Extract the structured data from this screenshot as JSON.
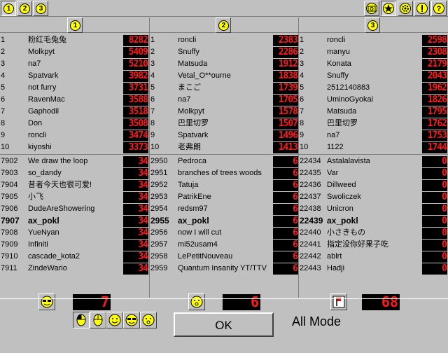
{
  "top_tabs": [
    "1",
    "2",
    "3"
  ],
  "top_right_icons": [
    "camera-icon",
    "star-icon",
    "settings-icon",
    "info-icon",
    "help-icon"
  ],
  "panels": [
    {
      "header": "1",
      "top": [
        {
          "rank": "1",
          "name": "粉红毛兔兔",
          "score": "8282"
        },
        {
          "rank": "2",
          "name": "Molkpyt",
          "score": "5409"
        },
        {
          "rank": "3",
          "name": "na7",
          "score": "5210"
        },
        {
          "rank": "4",
          "name": "Spatvark",
          "score": "3982"
        },
        {
          "rank": "5",
          "name": "not furry",
          "score": "3731"
        },
        {
          "rank": "6",
          "name": "RavenMac",
          "score": "3588"
        },
        {
          "rank": "7",
          "name": "Gaphodil",
          "score": "3518"
        },
        {
          "rank": "8",
          "name": "Don",
          "score": "3508"
        },
        {
          "rank": "9",
          "name": "roncli",
          "score": "3474"
        },
        {
          "rank": "10",
          "name": "kiyoshi",
          "score": "3373"
        }
      ],
      "nearby": [
        {
          "rank": "7902",
          "name": "We draw the loop",
          "score": "34"
        },
        {
          "rank": "7903",
          "name": "so_dandy",
          "score": "34"
        },
        {
          "rank": "7904",
          "name": "昔者今天也很可爱!",
          "score": "34"
        },
        {
          "rank": "7905",
          "name": "小飞",
          "score": "34"
        },
        {
          "rank": "7906",
          "name": "DudeAreShowering",
          "score": "34"
        },
        {
          "rank": "7907",
          "name": "ax_pokl",
          "score": "34",
          "me": true
        },
        {
          "rank": "7908",
          "name": "YueNyan",
          "score": "34"
        },
        {
          "rank": "7909",
          "name": "Infiniti",
          "score": "34"
        },
        {
          "rank": "7910",
          "name": "cascade_kota2",
          "score": "34"
        },
        {
          "rank": "7911",
          "name": "ZindeWario",
          "score": "34"
        }
      ],
      "footer_icon": "sunglasses-face-icon",
      "counter": "7"
    },
    {
      "header": "2",
      "top": [
        {
          "rank": "1",
          "name": "roncli",
          "score": "2383"
        },
        {
          "rank": "2",
          "name": "Snuffy",
          "score": "2286"
        },
        {
          "rank": "3",
          "name": "Matsuda",
          "score": "1912"
        },
        {
          "rank": "4",
          "name": "Vetal_O**ourne",
          "score": "1838"
        },
        {
          "rank": "5",
          "name": "まこご",
          "score": "1739"
        },
        {
          "rank": "6",
          "name": "na7",
          "score": "1705"
        },
        {
          "rank": "7",
          "name": "Molkpyt",
          "score": "1578"
        },
        {
          "rank": "8",
          "name": "巴里切罗",
          "score": "1507"
        },
        {
          "rank": "9",
          "name": "Spatvark",
          "score": "1496"
        },
        {
          "rank": "10",
          "name": "老弗朗",
          "score": "1413"
        }
      ],
      "nearby": [
        {
          "rank": "2950",
          "name": "Pedroca",
          "score": "6"
        },
        {
          "rank": "2951",
          "name": "branches of trees woods",
          "score": "6"
        },
        {
          "rank": "2952",
          "name": "Tatuja",
          "score": "6"
        },
        {
          "rank": "2953",
          "name": "PatrikEne",
          "score": "6"
        },
        {
          "rank": "2954",
          "name": "redsm97",
          "score": "6"
        },
        {
          "rank": "2955",
          "name": "ax_pokl",
          "score": "6",
          "me": true
        },
        {
          "rank": "2956",
          "name": "now I will cut",
          "score": "6"
        },
        {
          "rank": "2957",
          "name": "mi52usam4",
          "score": "6"
        },
        {
          "rank": "2958",
          "name": "LePetitNouveau",
          "score": "6"
        },
        {
          "rank": "2959",
          "name": "Quantum Insanity YT/TTV",
          "score": "6"
        }
      ],
      "footer_icon": "surprised-face-icon",
      "counter": "6"
    },
    {
      "header": "3",
      "top": [
        {
          "rank": "1",
          "name": "roncli",
          "score": "2598"
        },
        {
          "rank": "2",
          "name": "manyu",
          "score": "2308"
        },
        {
          "rank": "3",
          "name": "Konata",
          "score": "2179"
        },
        {
          "rank": "4",
          "name": "Snuffy",
          "score": "2043"
        },
        {
          "rank": "5",
          "name": "2512140883",
          "score": "1962"
        },
        {
          "rank": "6",
          "name": "UminoGyokai",
          "score": "1826"
        },
        {
          "rank": "7",
          "name": "Matsuda",
          "score": "1795"
        },
        {
          "rank": "8",
          "name": "巴里切罗",
          "score": "1762"
        },
        {
          "rank": "9",
          "name": "na7",
          "score": "1753"
        },
        {
          "rank": "10",
          "name": "1122",
          "score": "1744"
        }
      ],
      "nearby": [
        {
          "rank": "22434",
          "name": "Astalalavista",
          "score": "0"
        },
        {
          "rank": "22435",
          "name": "Var",
          "score": "0"
        },
        {
          "rank": "22436",
          "name": "Dillweed",
          "score": "0"
        },
        {
          "rank": "22437",
          "name": "Swoliczek",
          "score": "0"
        },
        {
          "rank": "22438",
          "name": "Unicron",
          "score": "0"
        },
        {
          "rank": "22439",
          "name": "ax_pokl",
          "score": "0",
          "me": true
        },
        {
          "rank": "22440",
          "name": "小さきもの",
          "score": "0"
        },
        {
          "rank": "22441",
          "name": "指定没你好果子吃",
          "score": "0"
        },
        {
          "rank": "22442",
          "name": "ablrt",
          "score": "0"
        },
        {
          "rank": "22443",
          "name": "Hadji",
          "score": "0"
        }
      ],
      "footer_icon": "flag-icon",
      "counter": "68"
    }
  ],
  "modes": [
    "mouse-left-icon",
    "mouse-icon",
    "smile-face-icon",
    "sunglasses-face-icon",
    "surprised-face-icon"
  ],
  "ok_label": "OK",
  "mode_label": "All Mode",
  "colors": {
    "bg": "#c0c0c0",
    "digit": "#ff1a1a",
    "face": "#ffff00"
  }
}
